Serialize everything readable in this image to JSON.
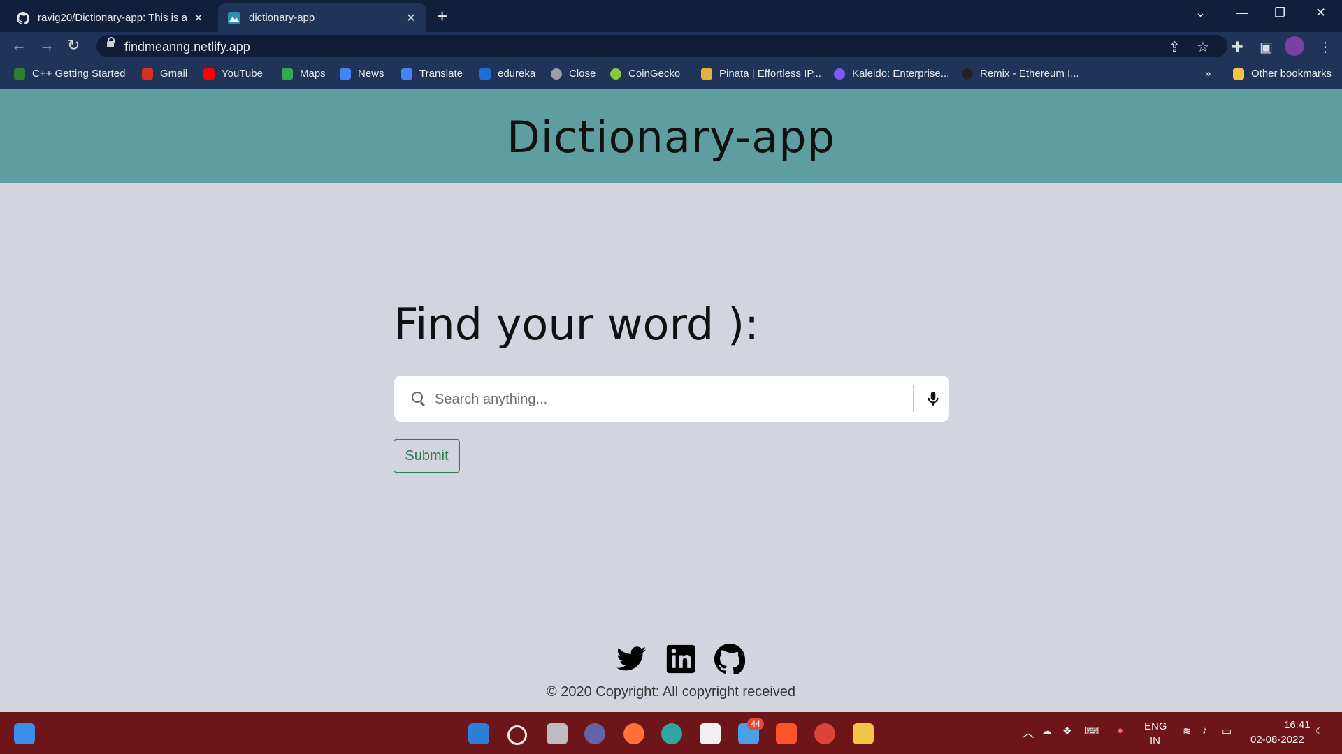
{
  "browser": {
    "tabs": [
      {
        "title": "ravig20/Dictionary-app: This is a",
        "active": false
      },
      {
        "title": "dictionary-app",
        "active": true
      }
    ],
    "url": "findmeanng.netlify.app",
    "bookmarks": [
      {
        "label": "C++ Getting Started",
        "icon": "w-icon",
        "color": "#2e7d32"
      },
      {
        "label": "Gmail",
        "icon": "gmail-icon",
        "color": "#d93025"
      },
      {
        "label": "YouTube",
        "icon": "youtube-icon",
        "color": "#ff0000"
      },
      {
        "label": "Maps",
        "icon": "maps-icon",
        "color": "#34a853"
      },
      {
        "label": "News",
        "icon": "news-icon",
        "color": "#4285f4"
      },
      {
        "label": "Translate",
        "icon": "translate-icon",
        "color": "#4285f4"
      },
      {
        "label": "edureka",
        "icon": "edureka-icon",
        "color": "#1d6fd6"
      },
      {
        "label": "Close",
        "icon": "globe-icon",
        "color": "#9aa0a6"
      },
      {
        "label": "CoinGecko",
        "icon": "coingecko-icon",
        "color": "#8dc63f"
      },
      {
        "label": "Pinata | Effortless IP...",
        "icon": "pinata-icon",
        "color": "#e5b23a"
      },
      {
        "label": "Kaleido: Enterprise...",
        "icon": "kaleido-icon",
        "color": "#7b5cff"
      },
      {
        "label": "Remix - Ethereum I...",
        "icon": "remix-icon",
        "color": "#222222"
      }
    ],
    "other_bookmarks": "Other bookmarks",
    "more_bookmarks": "»"
  },
  "app": {
    "header_title": "Dictionary-app",
    "heading": "Find your word ):",
    "search_placeholder": "Search anything...",
    "submit_label": "Submit",
    "copyright": "© 2020 Copyright: All copyright received"
  },
  "taskbar": {
    "mail_badge": "44",
    "lang_top": "ENG",
    "lang_bottom": "IN",
    "time": "16:41",
    "date": "02-08-2022"
  },
  "colors": {
    "header_bg": "#5f9ea0",
    "page_bg": "#d2d5dd",
    "submit_green": "#2e7d4f",
    "taskbar_bg": "#6d1519"
  }
}
